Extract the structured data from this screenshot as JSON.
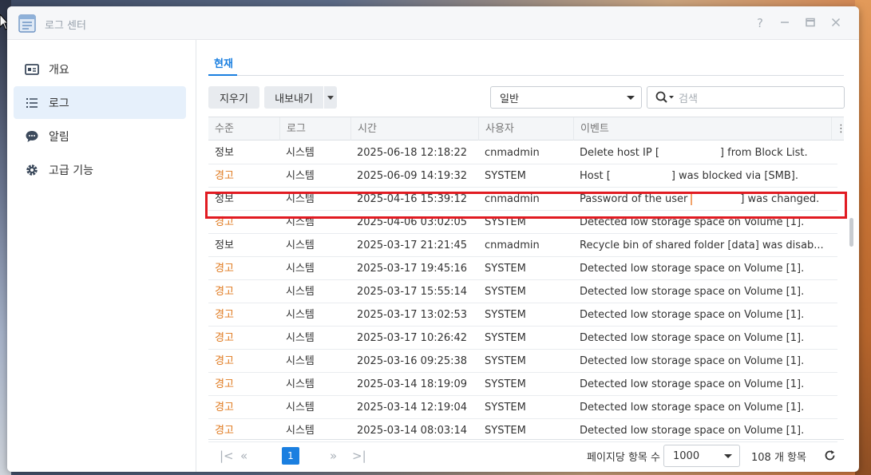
{
  "window": {
    "title": "로그 센터",
    "controls": [
      "help-icon",
      "minimize-icon",
      "maximize-icon",
      "close-icon"
    ]
  },
  "sidebar": {
    "items": [
      {
        "label": "개요",
        "icon": "overview-card-icon",
        "active": false
      },
      {
        "label": "로그",
        "icon": "list-icon",
        "active": true
      },
      {
        "label": "알림",
        "icon": "chat-bubble-icon",
        "active": false
      },
      {
        "label": "고급 기능",
        "icon": "gear-icon",
        "active": false
      }
    ]
  },
  "tabs": [
    {
      "label": "현재",
      "active": true
    }
  ],
  "toolbar": {
    "clear_label": "지우기",
    "export_label": "내보내기",
    "filter_value": "일반",
    "search_placeholder": "검색"
  },
  "table": {
    "headers": [
      "수준",
      "로그",
      "시간",
      "사용자",
      "이벤트"
    ],
    "rows": [
      {
        "level": "정보",
        "log": "시스템",
        "time": "2025-06-18 12:18:22",
        "user": "cnmadmin",
        "event_pre": "Delete host IP [",
        "event_post": "] from Block List.",
        "warn": false
      },
      {
        "level": "경고",
        "log": "시스템",
        "time": "2025-06-09 14:19:32",
        "user": "SYSTEM",
        "event_pre": "Host [",
        "event_post": "] was blocked via [SMB].",
        "warn": true
      },
      {
        "level": "정보",
        "log": "시스템",
        "time": "2025-04-16 15:39:12",
        "user": "cnmadmin",
        "event_pre": "Password of the user",
        "event_post": "] was changed.",
        "warn": false
      },
      {
        "level": "경고",
        "log": "시스템",
        "time": "2025-04-06 03:02:05",
        "user": "SYSTEM",
        "event": "Detected low storage space on Volume [1].",
        "warn": true
      },
      {
        "level": "정보",
        "log": "시스템",
        "time": "2025-03-17 21:21:45",
        "user": "cnmadmin",
        "event": "Recycle bin of shared folder [data] was disab...",
        "warn": false
      },
      {
        "level": "경고",
        "log": "시스템",
        "time": "2025-03-17 19:45:16",
        "user": "SYSTEM",
        "event": "Detected low storage space on Volume [1].",
        "warn": true
      },
      {
        "level": "경고",
        "log": "시스템",
        "time": "2025-03-17 15:55:14",
        "user": "SYSTEM",
        "event": "Detected low storage space on Volume [1].",
        "warn": true
      },
      {
        "level": "경고",
        "log": "시스템",
        "time": "2025-03-17 13:02:53",
        "user": "SYSTEM",
        "event": "Detected low storage space on Volume [1].",
        "warn": true
      },
      {
        "level": "경고",
        "log": "시스템",
        "time": "2025-03-17 10:26:42",
        "user": "SYSTEM",
        "event": "Detected low storage space on Volume [1].",
        "warn": true
      },
      {
        "level": "경고",
        "log": "시스템",
        "time": "2025-03-16 09:25:38",
        "user": "SYSTEM",
        "event": "Detected low storage space on Volume [1].",
        "warn": true
      },
      {
        "level": "경고",
        "log": "시스템",
        "time": "2025-03-14 18:19:09",
        "user": "SYSTEM",
        "event": "Detected low storage space on Volume [1].",
        "warn": true
      },
      {
        "level": "경고",
        "log": "시스템",
        "time": "2025-03-14 12:19:04",
        "user": "SYSTEM",
        "event": "Detected low storage space on Volume [1].",
        "warn": true
      },
      {
        "level": "경고",
        "log": "시스템",
        "time": "2025-03-14 08:03:14",
        "user": "SYSTEM",
        "event": "Detected low storage space on Volume [1].",
        "warn": true
      }
    ]
  },
  "pager": {
    "current_page": "1",
    "per_page_label": "페이지당 항목 수",
    "per_page_value": "1000",
    "total_label": "108 개 항목"
  },
  "colors": {
    "accent": "#1a7fe0",
    "warning": "#e07a1f",
    "highlight_box": "#e11b22",
    "sidebar_active_bg": "#e6f0fb"
  }
}
